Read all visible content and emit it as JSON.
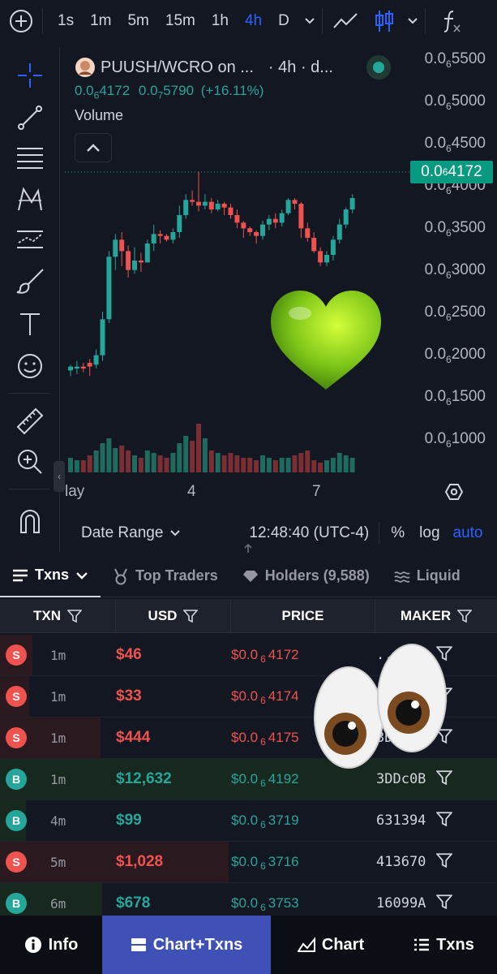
{
  "toolbar": {
    "timeframes": [
      "1s",
      "1m",
      "5m",
      "15m",
      "1h",
      "4h",
      "D"
    ],
    "active_timeframe": "4h"
  },
  "legend": {
    "symbol": "PUUSH/WCRO on ...",
    "interval": "· 4h · d...",
    "price_prefix_1": "0.0",
    "price_sub_1": "6",
    "price_rest_1": "4172",
    "price_prefix_2": "0.0",
    "price_sub_2": "7",
    "price_rest_2": "5790",
    "change": "(+16.11%)",
    "volume_label": "Volume"
  },
  "price_axis": [
    {
      "prefix": "0.0",
      "sub": "6",
      "rest": "5500"
    },
    {
      "prefix": "0.0",
      "sub": "6",
      "rest": "5000"
    },
    {
      "prefix": "0.0",
      "sub": "6",
      "rest": "4500"
    },
    {
      "prefix": "0.0",
      "sub": "6",
      "rest": "4000"
    },
    {
      "prefix": "0.0",
      "sub": "6",
      "rest": "3500"
    },
    {
      "prefix": "0.0",
      "sub": "6",
      "rest": "3000"
    },
    {
      "prefix": "0.0",
      "sub": "6",
      "rest": "2500"
    },
    {
      "prefix": "0.0",
      "sub": "6",
      "rest": "2000"
    },
    {
      "prefix": "0.0",
      "sub": "6",
      "rest": "1500"
    },
    {
      "prefix": "0.0",
      "sub": "6",
      "rest": "1000"
    }
  ],
  "current_price": {
    "prefix": "0.0",
    "sub": "6",
    "rest": "4172"
  },
  "x_axis": {
    "label_left": "lay",
    "label_mid": "4",
    "label_right": "7"
  },
  "range_bar": {
    "date_range": "Date Range",
    "time": "12:48:40 (UTC-4)",
    "percent": "%",
    "log": "log",
    "auto": "auto"
  },
  "tabs": [
    "Txns",
    "Top Traders",
    "Holders (9,588)",
    "Liquid"
  ],
  "table": {
    "headers": [
      "TXN",
      "USD",
      "PRICE",
      "MAKER"
    ],
    "rows": [
      {
        "type": "S",
        "age": "1m",
        "usd": "$46",
        "p_prefix": "$0.0",
        "p_sub": "6",
        "p_rest": "4172",
        "maker": "...98e"
      },
      {
        "type": "S",
        "age": "1m",
        "usd": "$33",
        "p_prefix": "$0.0",
        "p_sub": "6",
        "p_rest": "4174",
        "maker": ""
      },
      {
        "type": "S",
        "age": "1m",
        "usd": "$444",
        "p_prefix": "$0.0",
        "p_sub": "6",
        "p_rest": "4175",
        "maker": "3D"
      },
      {
        "type": "B",
        "age": "1m",
        "usd": "$12,632",
        "p_prefix": "$0.0",
        "p_sub": "6",
        "p_rest": "4192",
        "maker": "3DDc0B"
      },
      {
        "type": "B",
        "age": "4m",
        "usd": "$99",
        "p_prefix": "$0.0",
        "p_sub": "6",
        "p_rest": "3719",
        "maker": "631394"
      },
      {
        "type": "S",
        "age": "5m",
        "usd": "$1,028",
        "p_prefix": "$0.0",
        "p_sub": "6",
        "p_rest": "3716",
        "maker": "413670"
      },
      {
        "type": "B",
        "age": "6m",
        "usd": "$678",
        "p_prefix": "$0.0",
        "p_sub": "6",
        "p_rest": "3753",
        "maker": "16099A"
      }
    ]
  },
  "bottom_nav": [
    "Info",
    "Chart+Txns",
    "Chart",
    "Txns"
  ],
  "colors": {
    "up": "#26a69a",
    "down": "#ef5350",
    "accent": "#2962ff",
    "active_nav": "#3f51b5"
  }
}
